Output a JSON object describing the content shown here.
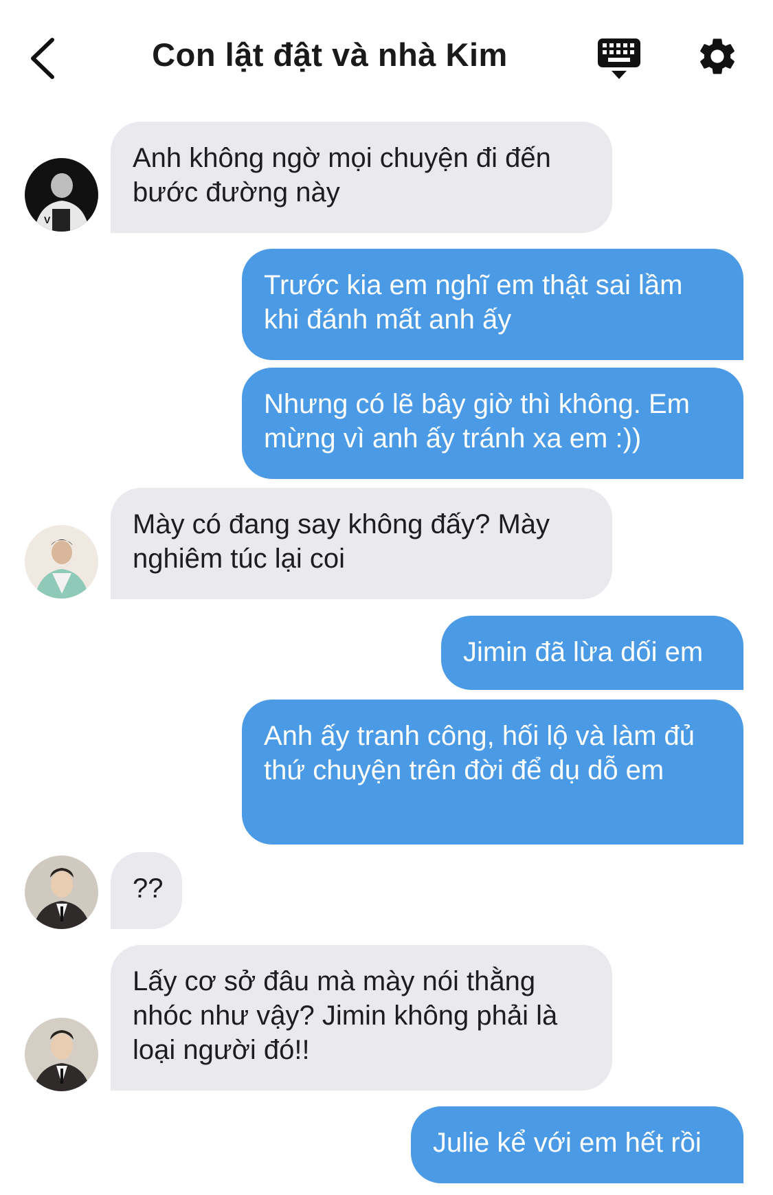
{
  "header": {
    "title": "Con lật đật và nhà Kim",
    "back_icon": "chevron-left-icon",
    "keyboard_icon": "keyboard-hide-icon",
    "settings_icon": "gear-icon"
  },
  "colors": {
    "outgoing_bubble": "#4a9ae5",
    "incoming_bubble": "#e9e9ee"
  },
  "messages": [
    {
      "side": "in",
      "text": "Anh không ngờ mọi chuyện đi đến bước đường này"
    },
    {
      "side": "out",
      "text": "Trước kia em nghĩ em thật sai lầm khi đánh mất anh ấy"
    },
    {
      "side": "out",
      "text": "Nhưng có lẽ bây giờ thì không. Em mừng vì anh ấy tránh xa em :))"
    },
    {
      "side": "in",
      "text": "Mày có đang say không đấy? Mày nghiêm túc lại coi"
    },
    {
      "side": "out",
      "text": "Jimin đã lừa dối em"
    },
    {
      "side": "out",
      "text": "Anh ấy tranh công, hối lộ và làm đủ thứ chuyện trên đời để dụ dỗ em"
    },
    {
      "side": "in",
      "text": "??"
    },
    {
      "side": "in",
      "text": "Lấy cơ sở đâu mà mày nói thằng nhóc như vậy? Jimin không phải là loại người đó!!"
    },
    {
      "side": "out",
      "text": "Julie kể với em hết rồi"
    }
  ]
}
